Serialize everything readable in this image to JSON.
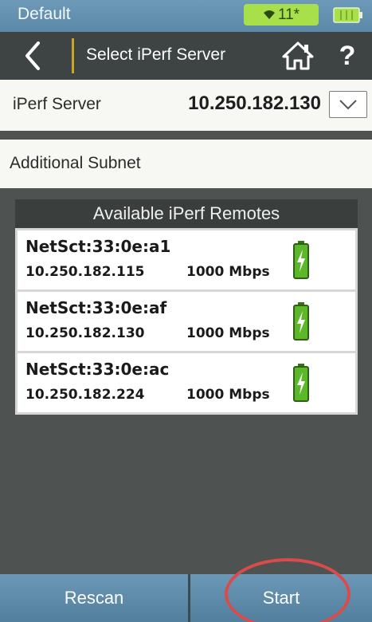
{
  "status_bar": {
    "profile": "Default",
    "wifi_channel": "11*",
    "wifi_glyph": "▾",
    "battery_color": "#a7e04a"
  },
  "title_bar": {
    "title": "Select iPerf Server",
    "help_glyph": "?",
    "icons": [
      "back-icon",
      "home-icon",
      "help-icon"
    ]
  },
  "server": {
    "label": "iPerf Server",
    "value": "10.250.182.130"
  },
  "subnet": {
    "label": "Additional Subnet"
  },
  "remotes": {
    "header": "Available iPerf Remotes",
    "items": [
      {
        "name": "NetSct:33:0e:a1",
        "ip": "10.250.182.115",
        "speed": "1000 Mbps"
      },
      {
        "name": "NetSct:33:0e:af",
        "ip": "10.250.182.130",
        "speed": "1000 Mbps"
      },
      {
        "name": "NetSct:33:0e:ac",
        "ip": "10.250.182.224",
        "speed": "1000 Mbps"
      }
    ]
  },
  "footer": {
    "rescan_label": "Rescan",
    "start_label": "Start"
  },
  "colors": {
    "accent": "#5c8bab",
    "highlight": "#d84c4c",
    "battery_green": "#5cb82a"
  }
}
